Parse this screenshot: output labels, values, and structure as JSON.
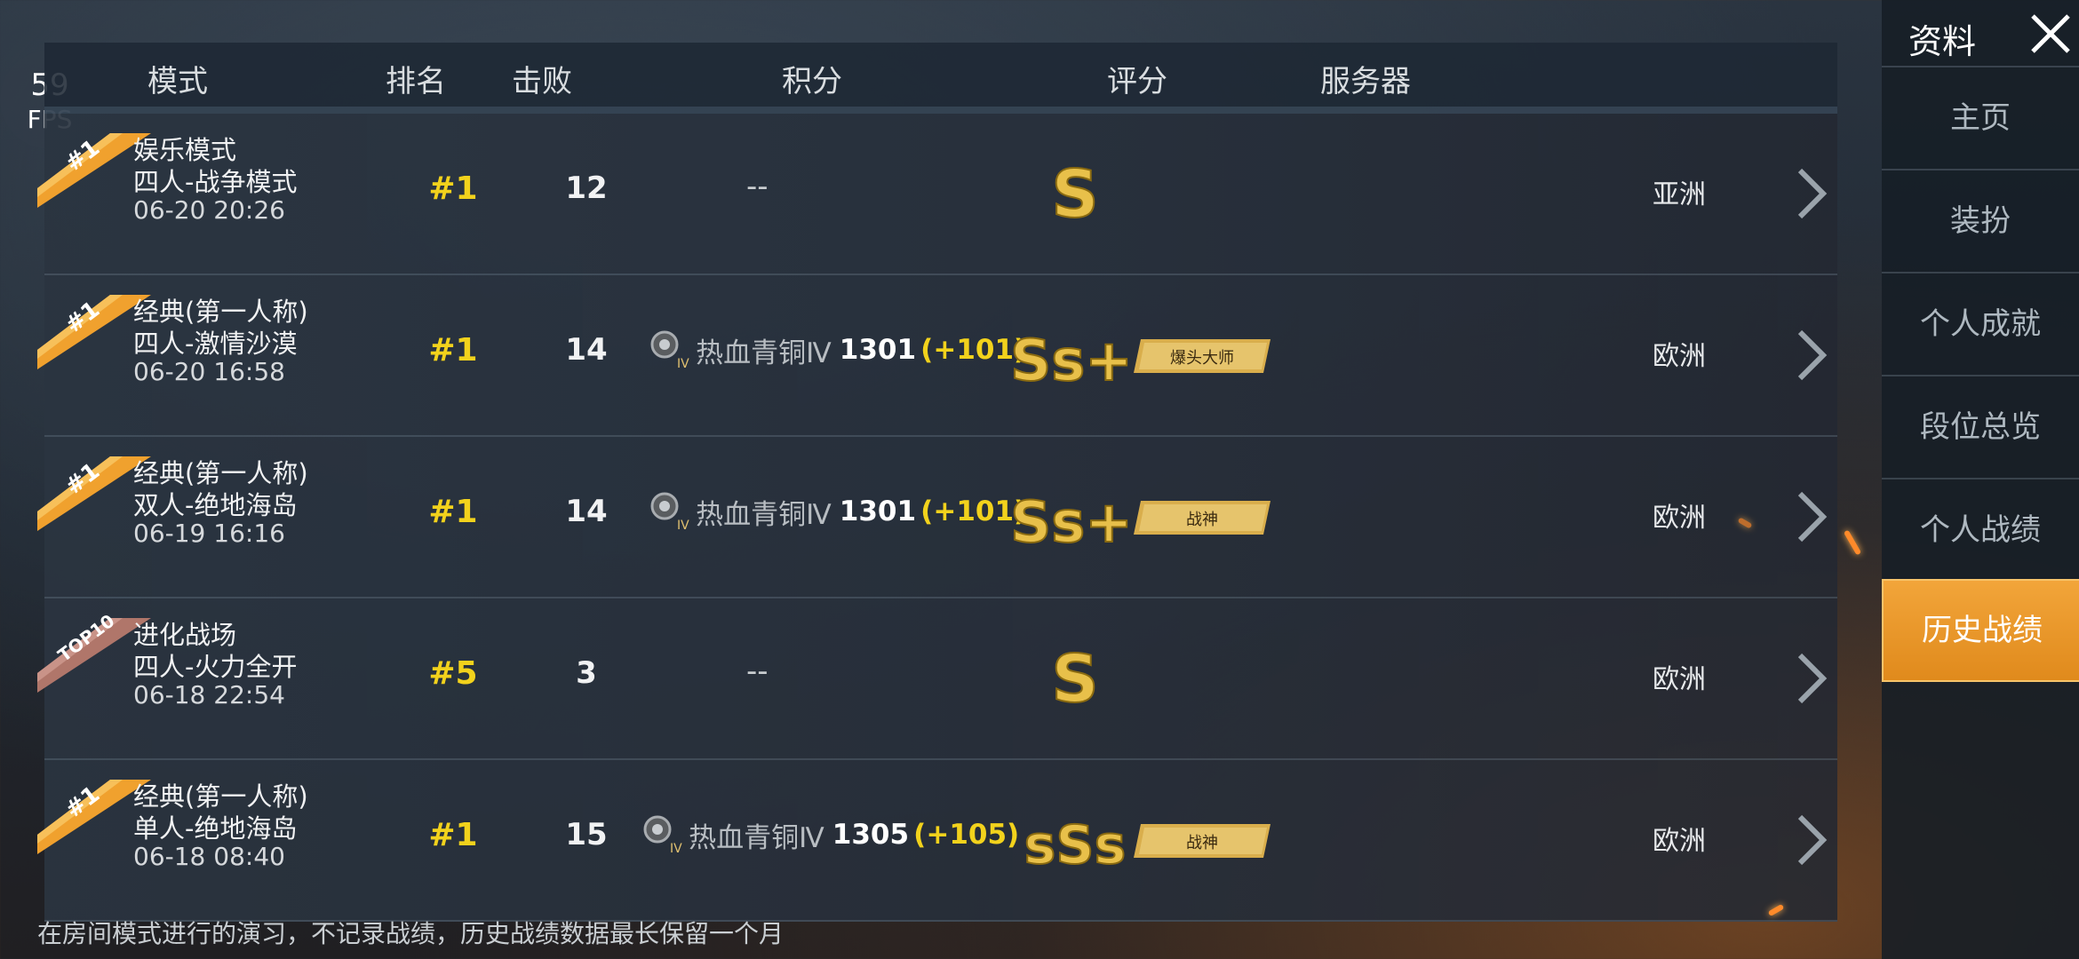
{
  "fps": {
    "value": "59",
    "label": "FPS"
  },
  "header": {
    "mode": "模式",
    "rank": "排名",
    "kills": "击败",
    "points": "积分",
    "grade": "评分",
    "server": "服务器"
  },
  "rows": [
    {
      "badge": "#1",
      "mode": "娱乐模式",
      "sub": "四人-战争模式",
      "time": "06-20 20:26",
      "rank": "#1",
      "kills": "12",
      "points_text": "--",
      "grade": "S",
      "server": "亚洲"
    },
    {
      "badge": "#1",
      "mode": "经典(第一人称)",
      "sub": "四人-激情沙漠",
      "time": "06-20 16:58",
      "rank": "#1",
      "kills": "14",
      "tier": "热血青铜Ⅳ",
      "points": "1301",
      "gain": "(+101)",
      "grade": "Ss+",
      "title": "爆头大师",
      "server": "欧洲"
    },
    {
      "badge": "#1",
      "mode": "经典(第一人称)",
      "sub": "双人-绝地海岛",
      "time": "06-19 16:16",
      "rank": "#1",
      "kills": "14",
      "tier": "热血青铜Ⅳ",
      "points": "1301",
      "gain": "(+101)",
      "grade": "Ss+",
      "title": "战神",
      "server": "欧洲"
    },
    {
      "badge": "TOP10",
      "mode": "进化战场",
      "sub": "四人-火力全开",
      "time": "06-18 22:54",
      "rank": "#5",
      "kills": "3",
      "points_text": "--",
      "grade": "S",
      "server": "欧洲"
    },
    {
      "badge": "#1",
      "mode": "经典(第一人称)",
      "sub": "单人-绝地海岛",
      "time": "06-18 08:40",
      "rank": "#1",
      "kills": "15",
      "tier": "热血青铜Ⅳ",
      "points": "1305",
      "gain": "(+105)",
      "grade": "sSs",
      "title": "战神",
      "server": "欧洲"
    }
  ],
  "footer_note": "在房间模式进行的演习，不记录战绩，历史战绩数据最长保留一个月",
  "sidebar": {
    "title": "资料",
    "items": [
      "主页",
      "装扮",
      "个人成就",
      "段位总览",
      "个人战绩",
      "历史战绩"
    ],
    "active": "历史战绩"
  },
  "colors": {
    "accent": "#f2a53a",
    "rank_yellow": "#f2d21c",
    "gold": "#e8c04a"
  }
}
